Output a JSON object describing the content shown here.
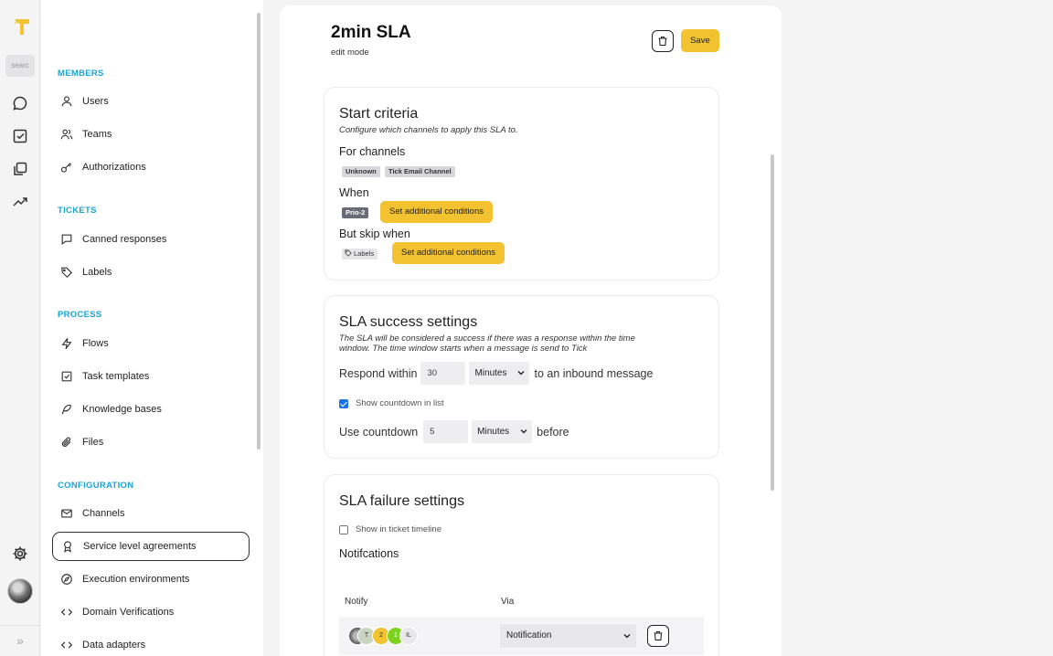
{
  "rail": {
    "search_placeholder": "searc",
    "icons": [
      "logo-icon",
      "chat-icon",
      "tasks-icon",
      "copy-icon",
      "trend-icon",
      "gear-icon"
    ],
    "expand_label": "»"
  },
  "sidebar": {
    "sections": {
      "members": "MEMBERS",
      "tickets": "TICKETS",
      "process": "PROCESS",
      "configuration": "CONFIGURATION"
    },
    "items": {
      "users": "Users",
      "teams": "Teams",
      "authorizations": "Authorizations",
      "canned": "Canned responses",
      "labels": "Labels",
      "flows": "Flows",
      "task_templates": "Task templates",
      "knowledge": "Knowledge bases",
      "files": "Files",
      "channels": "Channels",
      "sla": "Service level agreements",
      "exec_env": "Execution environments",
      "domain": "Domain Verifications",
      "adapters": "Data adapters"
    },
    "active_item": "Service level agreements"
  },
  "page": {
    "title": "2min SLA",
    "subtitle": "edit mode",
    "save_label": "Save"
  },
  "start": {
    "title": "Start criteria",
    "desc": "Configure which channels to apply this SLA to.",
    "channels_label": "For channels",
    "channels": [
      "Unknown",
      "Tick Email Channel"
    ],
    "when_label": "When",
    "when_chip": "Prio-2",
    "set_conditions": "Set additional conditions",
    "skip_label": "But skip when",
    "skip_chip": "Labels",
    "set_conditions_2": "Set additional conditions"
  },
  "success": {
    "title": "SLA success settings",
    "desc_1": "The SLA will be considered a success if there was a response within the time",
    "desc_2": "window. The time window starts when a message is send to Tick",
    "respond_label": "Respond within",
    "respond_value": "30",
    "respond_unit": "Minutes",
    "respond_suffix": "to an inbound message",
    "countdown_check_label": "Show countdown in list",
    "countdown_checked": true,
    "use_countdown_label": "Use countdown",
    "countdown_value": "5",
    "countdown_unit": "Minutes",
    "countdown_suffix": "before"
  },
  "failure": {
    "title": "SLA failure settings",
    "timeline_label": "Show in ticket timeline",
    "timeline_checked": false,
    "notifications_title": "Notifcations",
    "col_notify": "Notify",
    "col_via": "Via",
    "avatars": [
      "T",
      "2",
      "1",
      "IL"
    ],
    "via_value": "Notification"
  },
  "colors": {
    "accent": "#f2c230",
    "section": "#1aa3d6",
    "checkbox": "#1a73e8"
  }
}
